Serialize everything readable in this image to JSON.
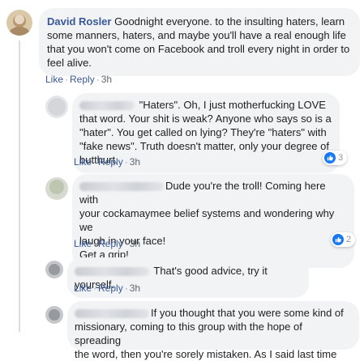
{
  "comments": [
    {
      "author": "David Rosler",
      "text": "Goodnight everyone. to the insulting haters, learn some manners, haters, and maybe you'll have a real enough life that you won't come on Facebook and troll every night in order to feel alive.",
      "actions": {
        "like": "Like",
        "reply": "Reply",
        "time": "3h"
      },
      "reactions": null
    },
    {
      "author": "",
      "text": "\"Haters\". Oh, I just motherfucking LOVE that word. Your shit is weak? Anyone who says so is a \"hater\". You get called on lying? They're \"haters\" with \"fake news\". Truth doesn't matter, only your degree of butthurt.",
      "actions": {
        "like": "Like",
        "reply": "Reply",
        "time": "3h"
      },
      "reactions": {
        "count": "3"
      }
    },
    {
      "author": "",
      "text_lines": [
        "Dude you're the troll! Coming here with",
        "your cockamaymee belief systems and wondering why we",
        "laugh in your face!",
        "Get a grip!"
      ],
      "actions": {
        "like": "Like",
        "reply": "Reply",
        "time": "3h"
      },
      "reactions": {
        "count": "2"
      }
    },
    {
      "author": "",
      "text": "That's good advice, try it yourself.",
      "actions": {
        "like": "Like",
        "reply": "Reply",
        "time": "3h"
      },
      "reactions": null
    },
    {
      "author": "",
      "text_lines": [
        "If you thought that you were some kind of",
        "missionary, coming to this group with the hope of spreading",
        "the word, then you're sorely mistaken. As I said last time"
      ]
    }
  ],
  "colors": {
    "link": "#385898",
    "bubble": "#f2f3f5",
    "like_blue": "#1877f2",
    "meta": "#606770"
  },
  "icons": {
    "reaction": "thumbs-up-icon"
  }
}
